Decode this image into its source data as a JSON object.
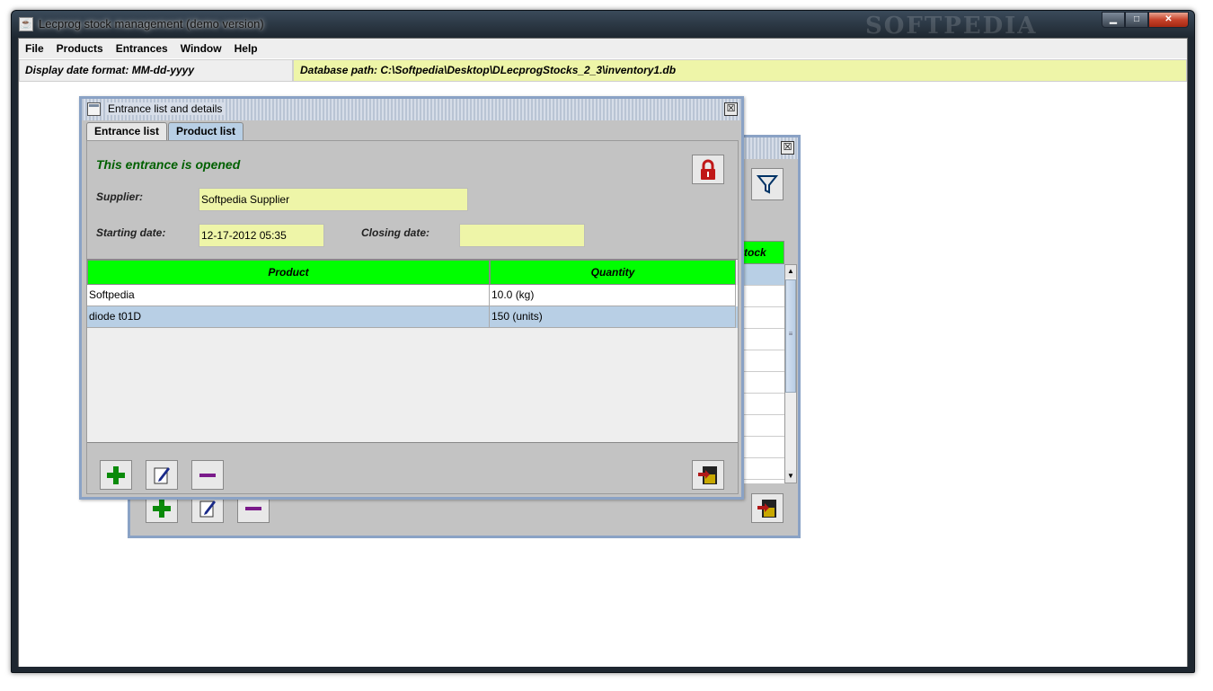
{
  "window": {
    "title": "Lecprog stock management (demo version)",
    "watermark": "SOFTPEDIA",
    "controls": {
      "minimize": "▁",
      "maximize": "□",
      "close": "✕"
    }
  },
  "menu": [
    "File",
    "Products",
    "Entrances",
    "Window",
    "Help"
  ],
  "status": {
    "date_format": "Display date format:  MM-dd-yyyy",
    "db_path": "Database path: C:\\Softpedia\\Desktop\\DLecprogStocks_2_3\\inventory1.db"
  },
  "back_frame": {
    "table_header": "tock",
    "close_glyph": "☒"
  },
  "front_frame": {
    "title": "Entrance list and details",
    "close_glyph": "☒",
    "tabs": [
      "Entrance list",
      "Product list"
    ],
    "active_tab": 1,
    "status_text": "This entrance is opened",
    "supplier_label": "Supplier:",
    "supplier_value": "Softpedia Supplier",
    "start_label": "Starting date:",
    "start_value": "12-17-2012  05:35",
    "closing_label": "Closing date:",
    "closing_value": "",
    "table": {
      "columns": [
        "Product",
        "Quantity"
      ],
      "rows": [
        [
          "Softpedia",
          "10.0 (kg)"
        ],
        [
          "diode t01D",
          "150 (units)"
        ]
      ]
    }
  },
  "icons": {
    "add": "add-icon",
    "edit": "edit-icon",
    "remove": "remove-icon",
    "exit": "exit-icon",
    "lock": "lock-icon",
    "filter": "filter-icon"
  },
  "colors": {
    "header_green": "#00ff00",
    "field_yellow": "#eef5a8",
    "selection_blue": "#b8cfe5",
    "status_green": "#006000"
  }
}
